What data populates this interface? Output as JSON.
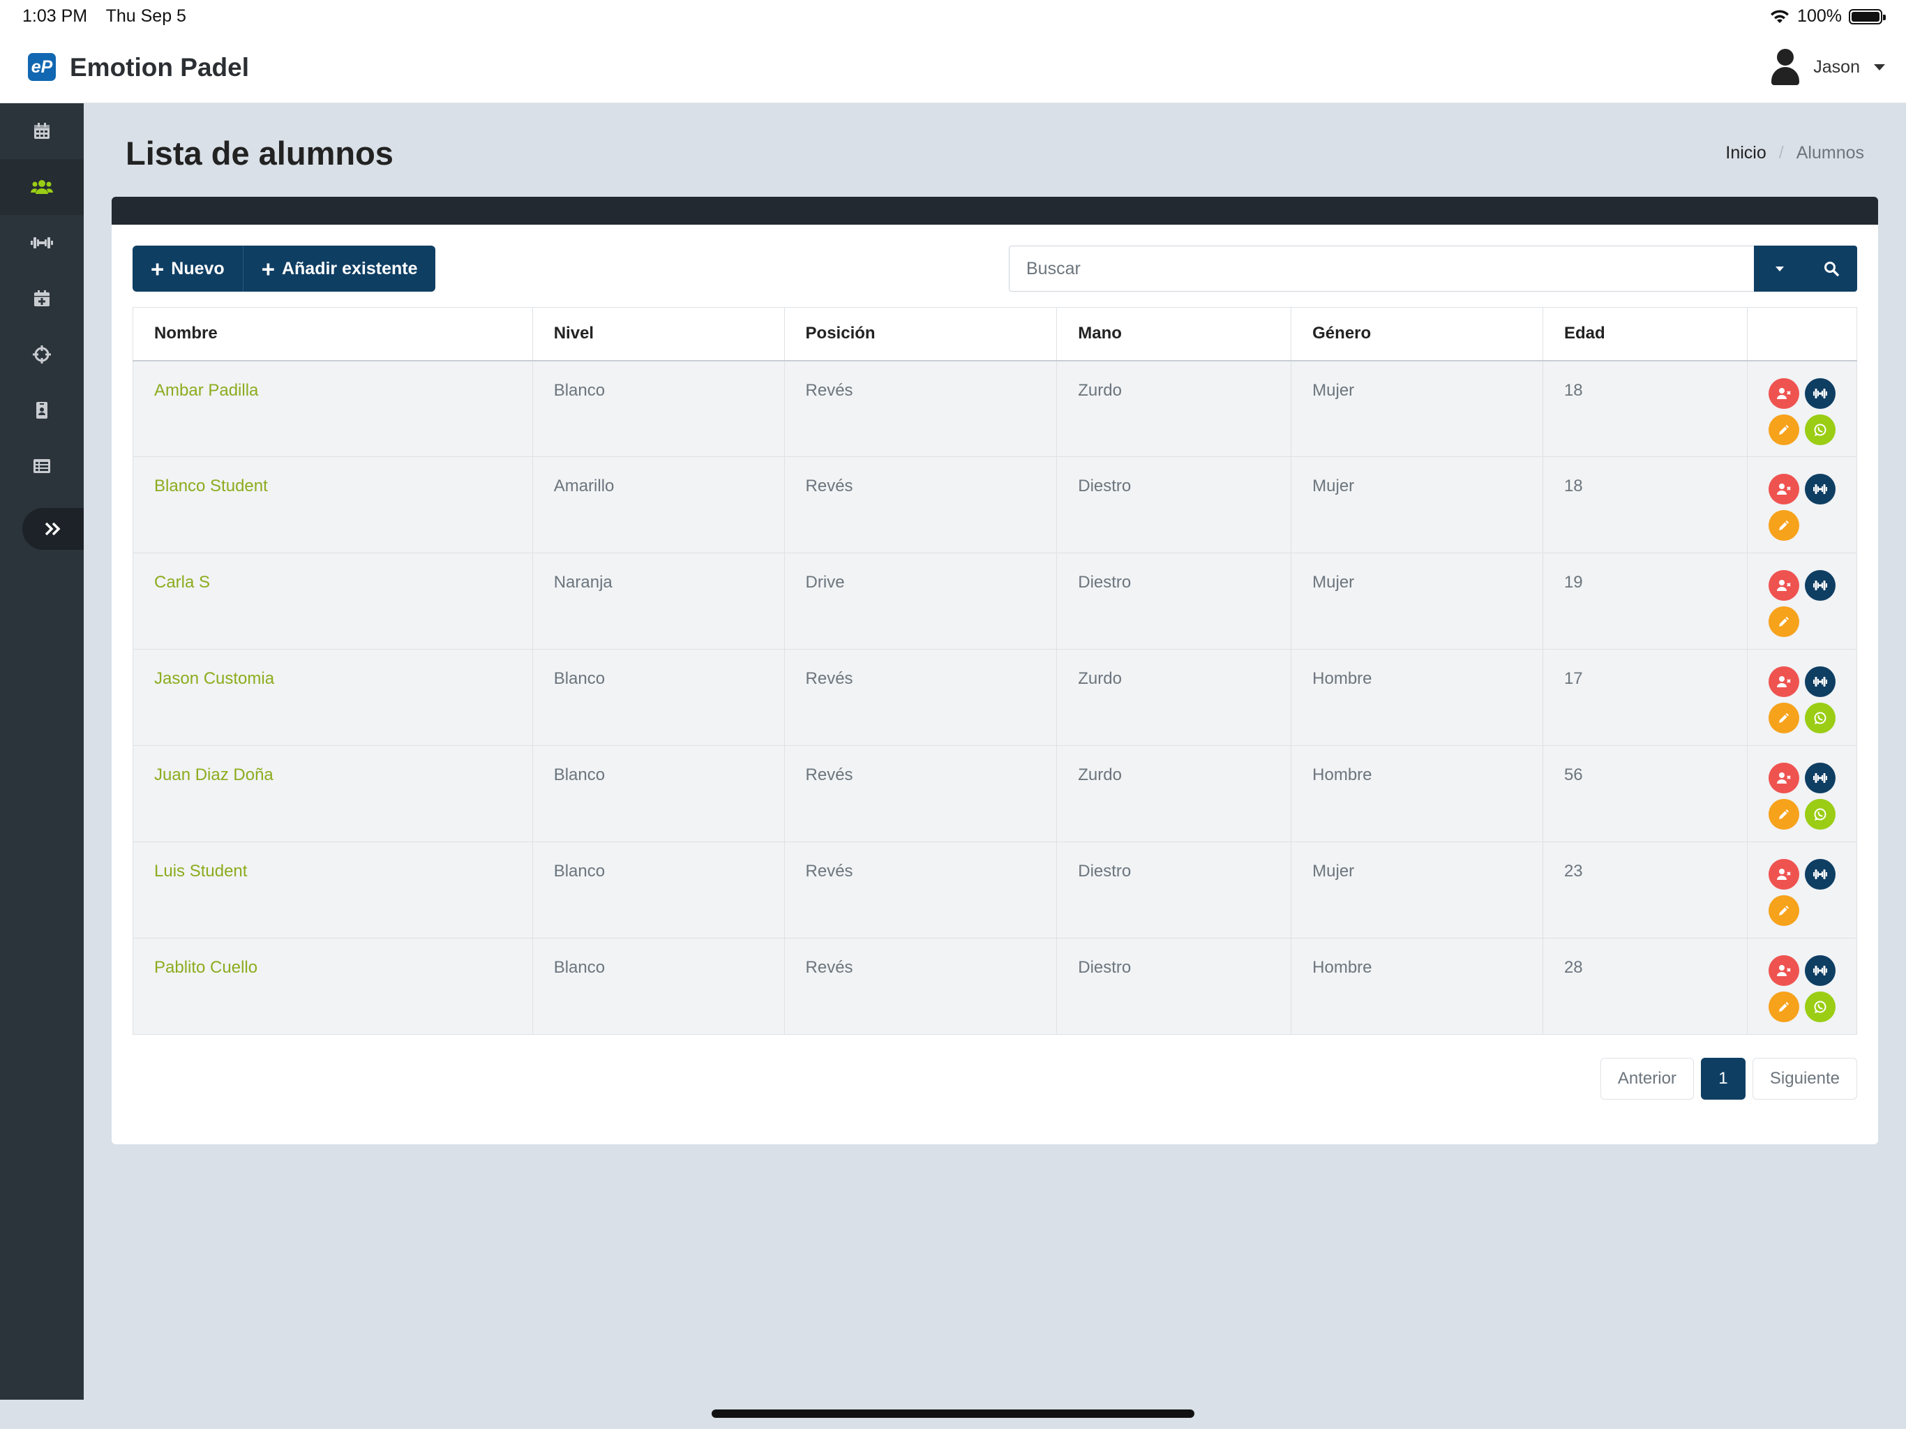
{
  "status_bar": {
    "time": "1:03 PM",
    "date": "Thu Sep 5",
    "battery": "100%"
  },
  "app": {
    "logo_text": "eP",
    "title": "Emotion Padel"
  },
  "user": {
    "name": "Jason"
  },
  "page": {
    "title": "Lista de alumnos"
  },
  "breadcrumb": {
    "home": "Inicio",
    "current": "Alumnos"
  },
  "toolbar": {
    "new_label": "Nuevo",
    "add_existing_label": "Añadir existente"
  },
  "search": {
    "placeholder": "Buscar"
  },
  "table": {
    "headers": [
      "Nombre",
      "Nivel",
      "Posición",
      "Mano",
      "Género",
      "Edad"
    ],
    "rows": [
      {
        "nombre": "Ambar Padilla",
        "nivel": "Blanco",
        "posicion": "Revés",
        "mano": "Zurdo",
        "genero": "Mujer",
        "edad": "18",
        "whatsapp": true
      },
      {
        "nombre": "Blanco Student",
        "nivel": "Amarillo",
        "posicion": "Revés",
        "mano": "Diestro",
        "genero": "Mujer",
        "edad": "18",
        "whatsapp": false
      },
      {
        "nombre": "Carla S",
        "nivel": "Naranja",
        "posicion": "Drive",
        "mano": "Diestro",
        "genero": "Mujer",
        "edad": "19",
        "whatsapp": false
      },
      {
        "nombre": "Jason Customia",
        "nivel": "Blanco",
        "posicion": "Revés",
        "mano": "Zurdo",
        "genero": "Hombre",
        "edad": "17",
        "whatsapp": true
      },
      {
        "nombre": "Juan Diaz Doña",
        "nivel": "Blanco",
        "posicion": "Revés",
        "mano": "Zurdo",
        "genero": "Hombre",
        "edad": "56",
        "whatsapp": true
      },
      {
        "nombre": "Luis Student",
        "nivel": "Blanco",
        "posicion": "Revés",
        "mano": "Diestro",
        "genero": "Mujer",
        "edad": "23",
        "whatsapp": false
      },
      {
        "nombre": "Pablito Cuello",
        "nivel": "Blanco",
        "posicion": "Revés",
        "mano": "Diestro",
        "genero": "Hombre",
        "edad": "28",
        "whatsapp": true
      }
    ]
  },
  "pagination": {
    "prev": "Anterior",
    "current": "1",
    "next": "Siguiente"
  },
  "sidebar": {
    "items": [
      {
        "icon": "calendar-icon",
        "active": false
      },
      {
        "icon": "users-icon",
        "active": true
      },
      {
        "icon": "dumbbell-icon",
        "active": false
      },
      {
        "icon": "calendar-plus-icon",
        "active": false
      },
      {
        "icon": "crosshairs-icon",
        "active": false
      },
      {
        "icon": "id-badge-icon",
        "active": false
      },
      {
        "icon": "list-icon",
        "active": false
      }
    ]
  },
  "colors": {
    "primary": "#0f3e63",
    "accent_green": "#8cac1d",
    "danger": "#ef5350",
    "warning": "#f7a21b",
    "whatsapp": "#9acd14"
  }
}
